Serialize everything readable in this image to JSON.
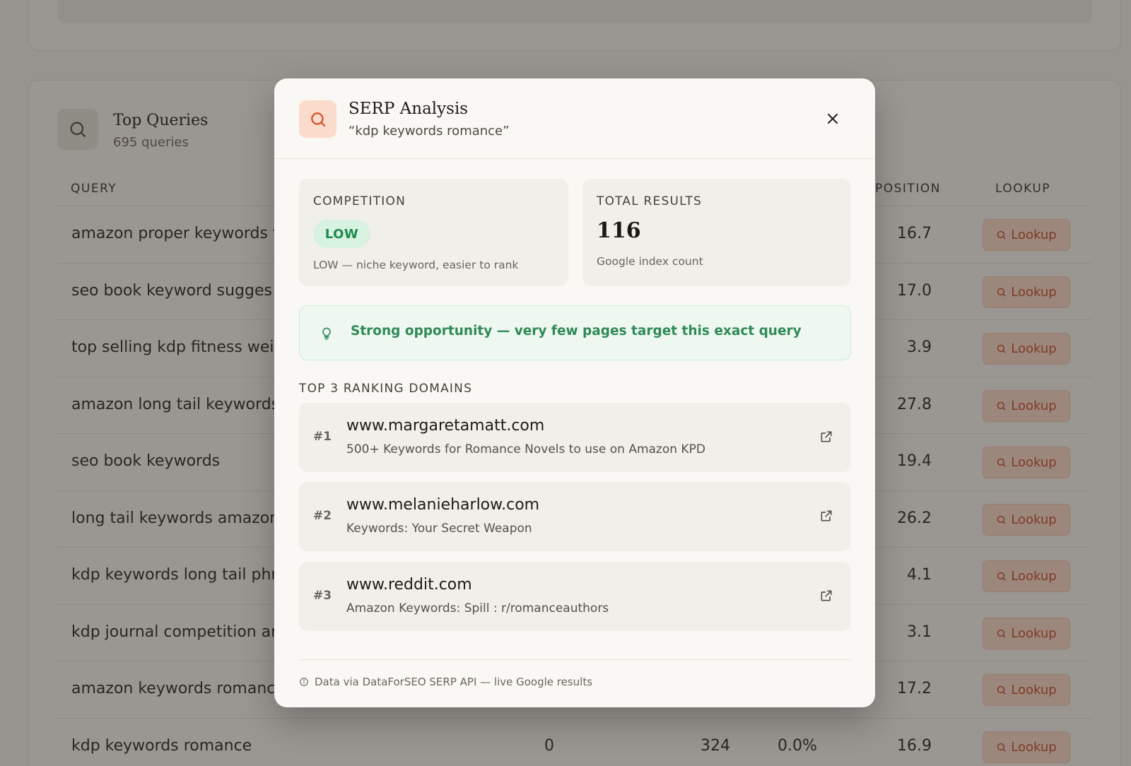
{
  "background": {
    "top_queries": {
      "title": "Top Queries",
      "subtitle": "695 queries"
    },
    "columns": {
      "query": "QUERY",
      "position": "POSITION",
      "lookup": "LOOKUP"
    },
    "lookup_label": "Lookup",
    "rows": [
      {
        "query": "amazon proper keywords f",
        "position": "16.7"
      },
      {
        "query": "seo book keyword sugges",
        "position": "17.0"
      },
      {
        "query": "top selling kdp fitness wei",
        "position": "3.9"
      },
      {
        "query": "amazon long tail keywords",
        "position": "27.8"
      },
      {
        "query": "seo book keywords",
        "position": "19.4"
      },
      {
        "query": "long tail keywords amazon",
        "position": "26.2"
      },
      {
        "query": "kdp keywords long tail phr",
        "position": "4.1"
      },
      {
        "query": "kdp journal competition an",
        "position": "3.1"
      },
      {
        "query": "amazon keywords romanc",
        "position": "17.2"
      },
      {
        "query": "kdp keywords romance",
        "clicks": "0",
        "impressions": "324",
        "ctr": "0.0%",
        "position": "16.9"
      }
    ]
  },
  "modal": {
    "title": "SERP Analysis",
    "subtitle": "“kdp keywords romance”",
    "competition": {
      "label": "COMPETITION",
      "badge": "LOW",
      "note": "LOW — niche keyword, easier to rank"
    },
    "total_results": {
      "label": "TOTAL RESULTS",
      "value": "116",
      "note": "Google index count"
    },
    "opportunity": "Strong opportunity — very few pages target this exact query",
    "domains_label": "TOP 3 RANKING DOMAINS",
    "domains": [
      {
        "rank": "#1",
        "domain": "www.margaretamatt.com",
        "title": "500+ Keywords for Romance Novels to use on Amazon KPD"
      },
      {
        "rank": "#2",
        "domain": "www.melanieharlow.com",
        "title": "Keywords: Your Secret Weapon"
      },
      {
        "rank": "#3",
        "domain": "www.reddit.com",
        "title": "Amazon Keywords: Spill : r/romanceauthors"
      }
    ],
    "footer": "Data via DataForSEO SERP API — live Google results"
  },
  "colors": {
    "accent": "#c8502b",
    "accent_bg": "#fbd9cb",
    "success": "#2f8a56",
    "success_bg": "#eef8f1"
  }
}
